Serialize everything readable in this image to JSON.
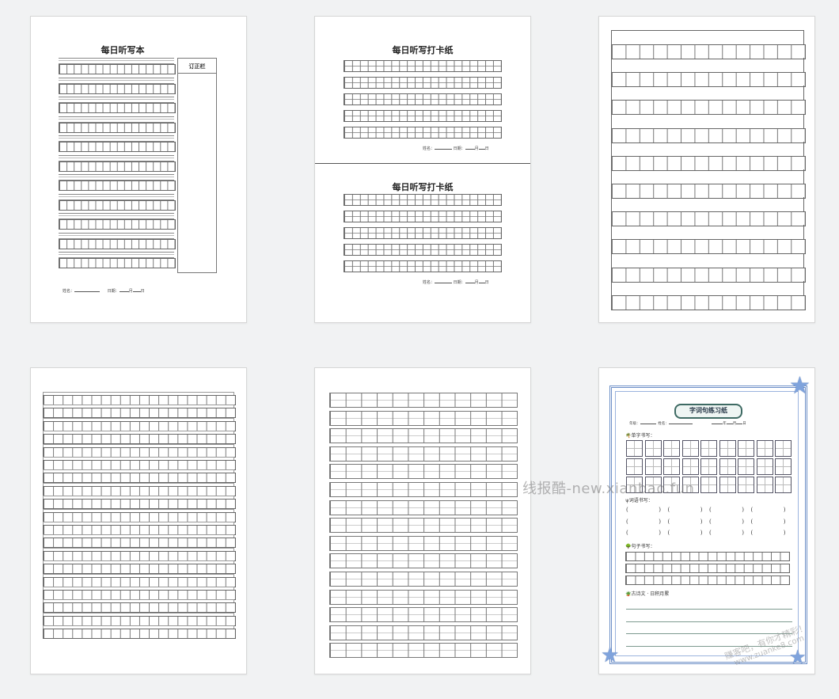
{
  "thumbnails": [
    {
      "id": "t1",
      "title": "每日听写本",
      "side_label": "订正栏",
      "footer_name": "姓名：",
      "footer_date": "日期：",
      "footer_month": "月",
      "footer_day": "日"
    },
    {
      "id": "t2",
      "title_top": "每日听写打卡纸",
      "title_bottom": "每日听写打卡纸",
      "footer_name": "姓名：",
      "footer_date": "日期：",
      "footer_month": "月",
      "footer_day": "日"
    },
    {
      "id": "t3"
    },
    {
      "id": "t4"
    },
    {
      "id": "t5"
    },
    {
      "id": "t6",
      "title": "字词句练习纸",
      "field_grade": "年级：",
      "field_name": "姓名：",
      "field_year": "年",
      "field_month": "月",
      "field_day": "日",
      "section_1": "单字书写：",
      "section_2": "词语书写：",
      "section_3": "句子书写：",
      "section_4": "古诗文 · 日积月累"
    }
  ],
  "watermark": "线报酷-new.xianbao.fun",
  "stamp_line1": "赚客吧，有你才精彩！",
  "stamp_line2": "www.zuanke8.com"
}
